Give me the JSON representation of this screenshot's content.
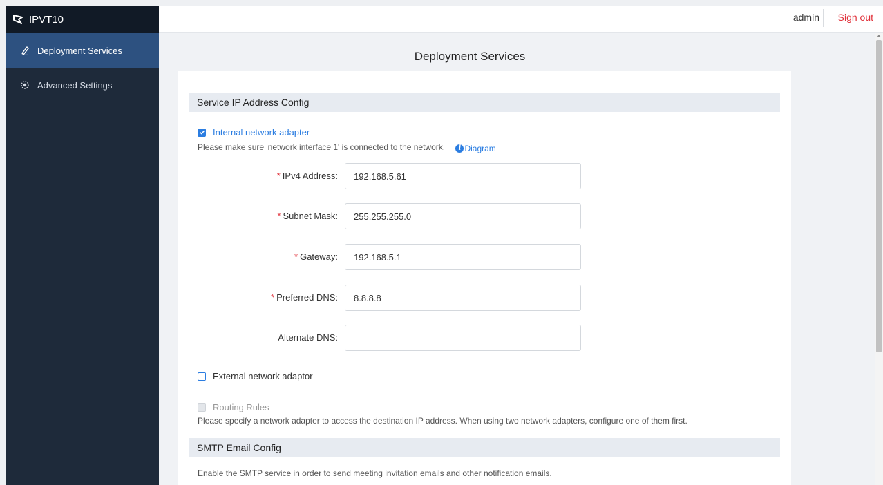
{
  "app": {
    "brand": "IPVT10"
  },
  "topbar": {
    "user": "admin",
    "signout": "Sign out"
  },
  "sidebar": {
    "items": [
      {
        "label": "Deployment Services",
        "icon": "pencil-icon",
        "active": true
      },
      {
        "label": "Advanced Settings",
        "icon": "gear-icon",
        "active": false
      }
    ]
  },
  "page": {
    "title": "Deployment Services"
  },
  "service_ip": {
    "header": "Service IP Address Config",
    "internal_adapter": {
      "label": "Internal network adapter",
      "checked": true
    },
    "hint_prefix": "Please make sure 'network interface 1' is connected to the network.",
    "diagram_link": "Diagram",
    "fields": [
      {
        "label": "IPv4 Address:",
        "required": true,
        "value": "192.168.5.61"
      },
      {
        "label": "Subnet Mask:",
        "required": true,
        "value": "255.255.255.0"
      },
      {
        "label": "Gateway:",
        "required": true,
        "value": "192.168.5.1"
      },
      {
        "label": "Preferred DNS:",
        "required": true,
        "value": "8.8.8.8"
      },
      {
        "label": "Alternate DNS:",
        "required": false,
        "value": ""
      }
    ],
    "external_adapter": {
      "label": "External network adaptor",
      "checked": false
    },
    "routing_rules": {
      "label": "Routing Rules",
      "disabled": true
    },
    "routing_hint": "Please specify a network adapter to access the destination IP address. When using two network adapters, configure one of them first."
  },
  "smtp": {
    "header": "SMTP Email Config",
    "hint": "Enable the SMTP service in order to send meeting invitation emails and other notification emails."
  },
  "colors": {
    "accent": "#2b7de1",
    "danger": "#e1323b",
    "sidebar": "#1e2a3a",
    "sidebar_active": "#2d5180"
  },
  "required_mark": "*"
}
